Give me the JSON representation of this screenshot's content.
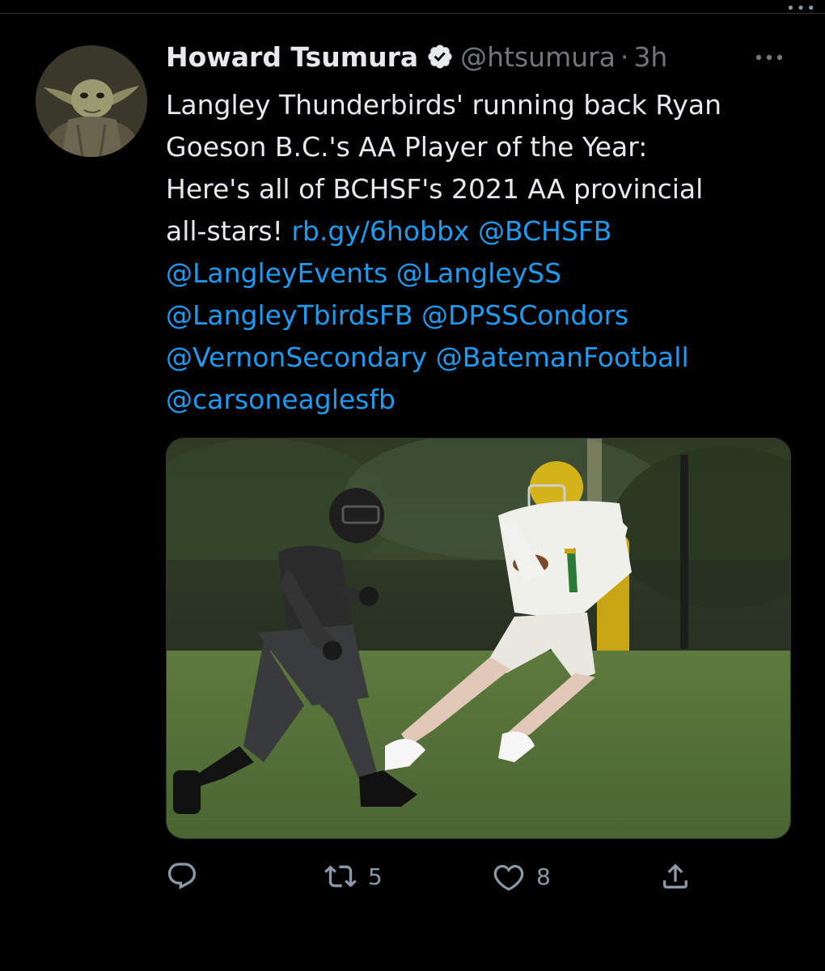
{
  "tweet": {
    "display_name": "Howard Tsumura",
    "handle": "@htsumura",
    "separator": "·",
    "timestamp": "3h",
    "text_lines": [
      [
        {
          "t": "Langley Thunderbirds' running back Ryan",
          "link": false
        }
      ],
      [
        {
          "t": "Goeson B.C.'s AA Player of the Year:",
          "link": false
        }
      ],
      [
        {
          "t": "Here's all of BCHSF's 2021 AA provincial",
          "link": false
        }
      ],
      [
        {
          "t": "all-stars! ",
          "link": false
        },
        {
          "t": "rb.gy/6hobbx",
          "link": true
        },
        {
          "t": " ",
          "link": false
        },
        {
          "t": "@BCHSFB",
          "link": true
        }
      ],
      [
        {
          "t": "@LangleyEvents",
          "link": true
        },
        {
          "t": " ",
          "link": false
        },
        {
          "t": "@LangleySS",
          "link": true
        }
      ],
      [
        {
          "t": "@LangleyTbirdsFB",
          "link": true
        },
        {
          "t": " ",
          "link": false
        },
        {
          "t": "@DPSSCondors",
          "link": true
        }
      ],
      [
        {
          "t": "@VernonSecondary",
          "link": true
        },
        {
          "t": " ",
          "link": false
        },
        {
          "t": "@BatemanFootball",
          "link": true
        }
      ],
      [
        {
          "t": "@carsoneaglesfb",
          "link": true
        }
      ]
    ]
  },
  "actions": {
    "reply_count": "",
    "retweet_count": "5",
    "like_count": "8"
  },
  "icons": {
    "verified": "verified-badge-icon",
    "more": "more-options-icon",
    "reply": "reply-icon",
    "retweet": "retweet-icon",
    "like": "heart-icon",
    "share": "share-icon"
  },
  "colors": {
    "background": "#000000",
    "text": "#e7e9ea",
    "secondary": "#71767b",
    "link": "#1d9bf0"
  }
}
